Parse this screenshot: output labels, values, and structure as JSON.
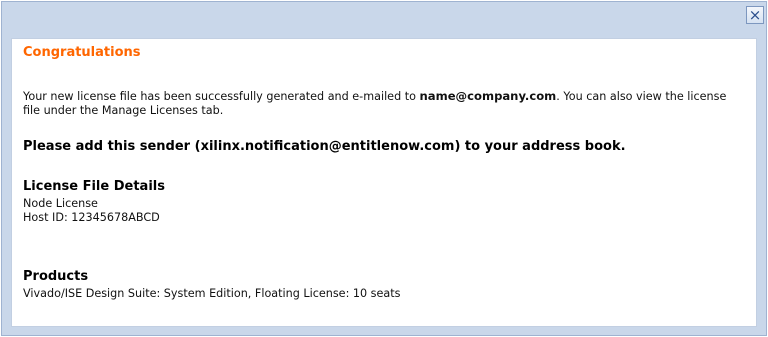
{
  "close_label": "×",
  "heading": "Congratulations",
  "message": {
    "part1": "Your new license file has been successfully generated and e-mailed to",
    "email": "name@company.com",
    "part2": ". You can also view the license file under the Manage Licenses tab."
  },
  "notice": "Please add this sender (xilinx.notification@entitlenow.com) to your address book.",
  "license_details": {
    "title": "License File Details",
    "type": "Node License",
    "host_id": "Host ID: 12345678ABCD"
  },
  "products": {
    "title": "Products",
    "item": "Vivado/ISE Design Suite: System Edition, Floating License: 10 seats"
  },
  "colors": {
    "heading": "#ff6600",
    "frame": "#c9d7ea"
  }
}
